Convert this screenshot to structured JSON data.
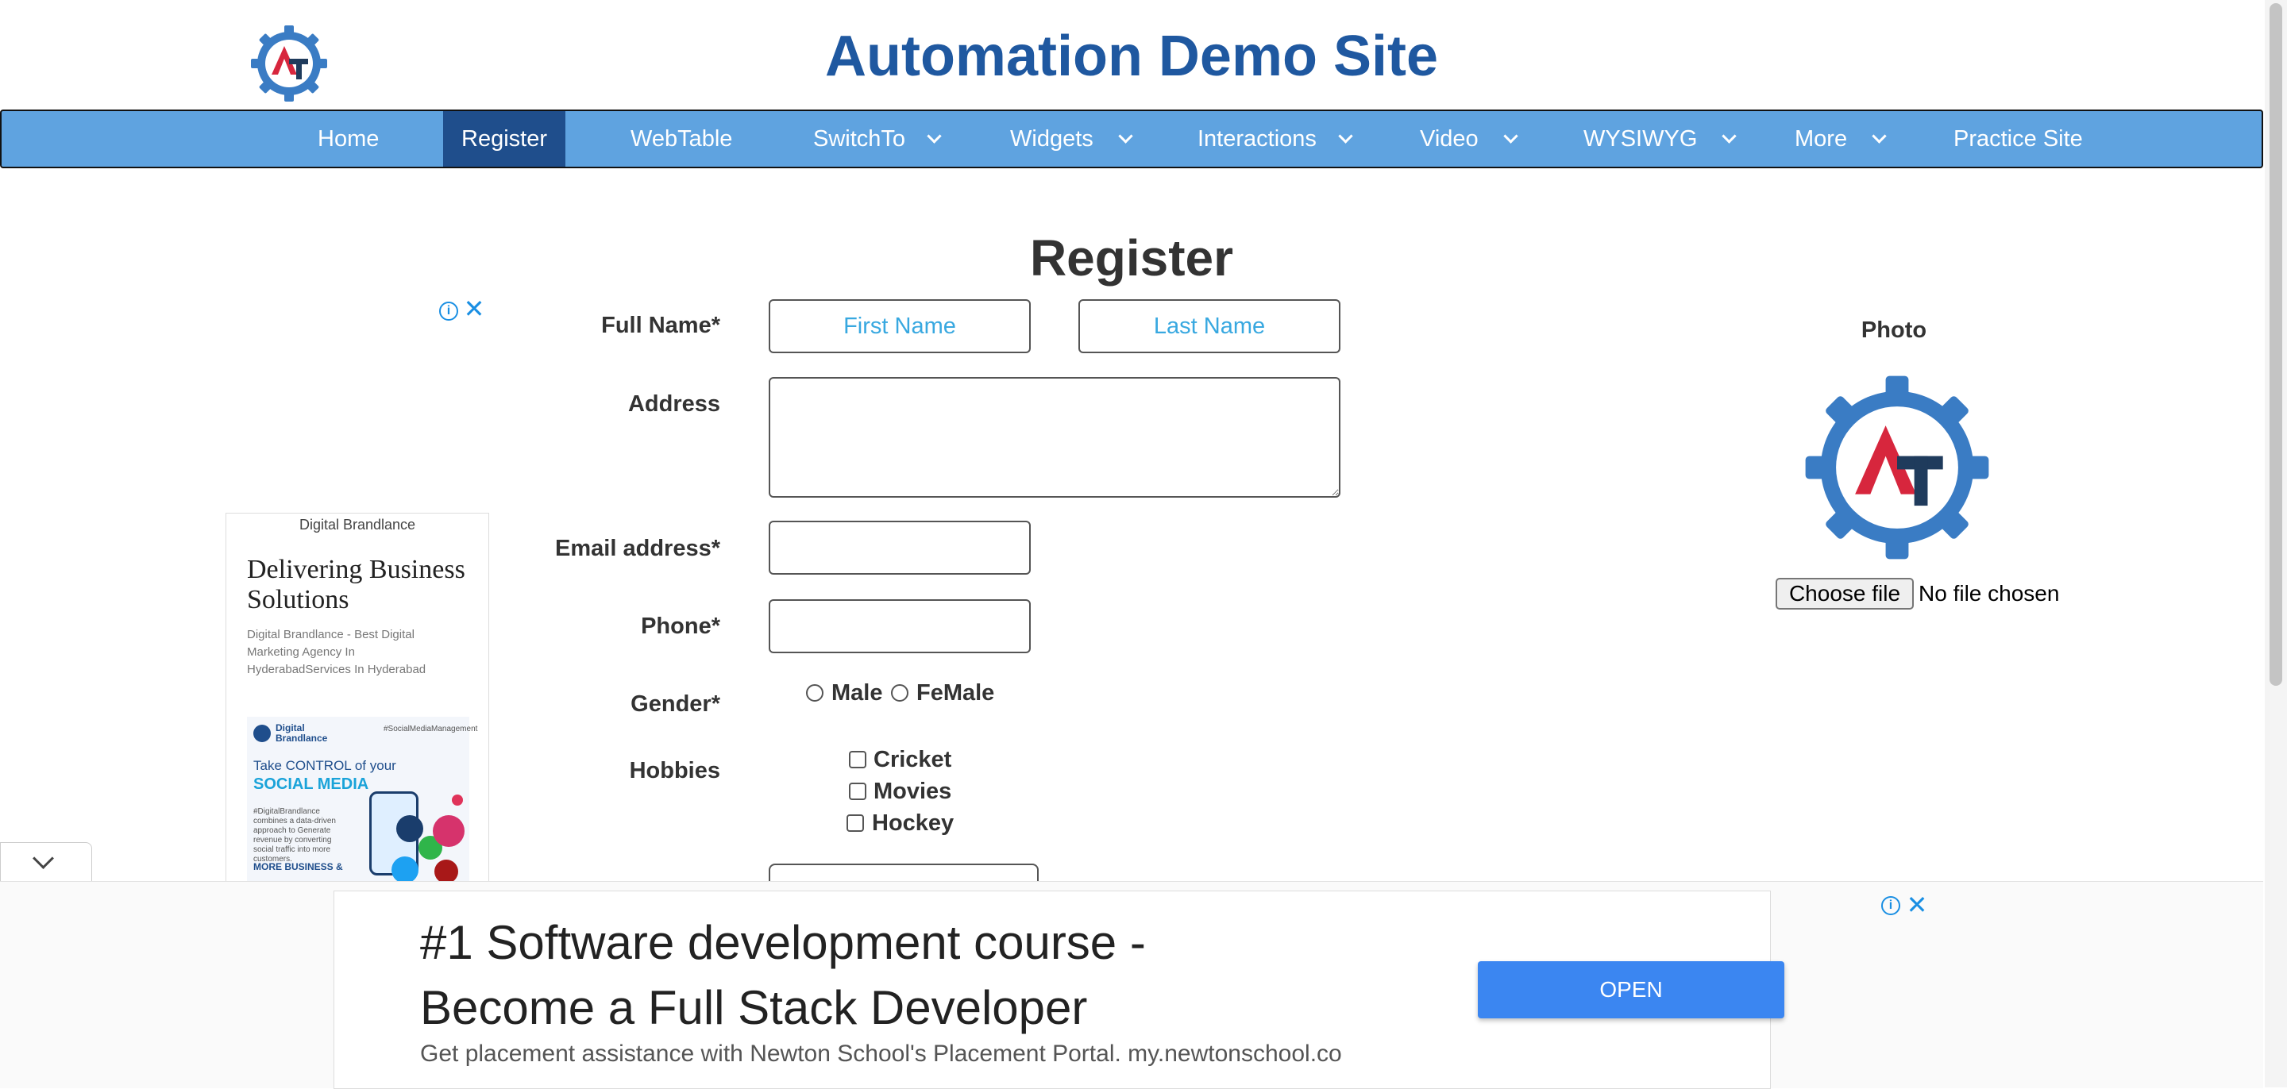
{
  "site": {
    "title": "Automation Demo Site"
  },
  "nav": {
    "items": [
      {
        "label": "Home"
      },
      {
        "label": "Register"
      },
      {
        "label": "WebTable"
      },
      {
        "label": "SwitchTo"
      },
      {
        "label": "Widgets"
      },
      {
        "label": "Interactions"
      },
      {
        "label": "Video"
      },
      {
        "label": "WYSIWYG"
      },
      {
        "label": "More"
      },
      {
        "label": "Practice Site"
      }
    ],
    "active": "Register"
  },
  "form": {
    "heading": "Register",
    "full_name_label": "Full Name*",
    "first_name_placeholder": "First Name",
    "last_name_placeholder": "Last Name",
    "address_label": "Address",
    "email_label": "Email address*",
    "phone_label": "Phone*",
    "gender_label": "Gender*",
    "gender_options": [
      "Male",
      "FeMale"
    ],
    "hobbies_label": "Hobbies",
    "hobbies_options": [
      "Cricket",
      "Movies",
      "Hockey"
    ]
  },
  "photo": {
    "label": "Photo",
    "choose_button": "Choose file",
    "status": "No file chosen"
  },
  "side_ad": {
    "brand": "Digital Brandlance",
    "title": "Delivering Business Solutions",
    "description": "Digital Brandlance - Best Digital Marketing Agency In HyderabadServices In Hyderabad",
    "image_brand": "Digital Brandlance",
    "image_tag": "#SocialMediaManagement",
    "image_take": "Take CONTROL of your",
    "image_social": "SOCIAL MEDIA",
    "image_body": "#DigitalBrandlance combines a data-driven approach to Generate revenue by converting social traffic into more customers.",
    "image_more": "MORE BUSINESS &"
  },
  "bottom_ad": {
    "headline": "#1 Software development course - Become a Full Stack Developer",
    "subtext": "Get placement assistance with Newton School's Placement Portal. my.newtonschool.co",
    "cta": "OPEN"
  },
  "colors": {
    "nav_bg": "#5fa3e0",
    "nav_active": "#1f4e8c",
    "title": "#1f58a0",
    "placeholder": "#38a8e0",
    "ad_button": "#3b86f1",
    "logo_red": "#d7263d",
    "logo_dark": "#1f3b5c",
    "logo_blue": "#3a7cc4"
  },
  "icons": {
    "logo": "automation-testing-gear-logo",
    "ad_info": "info-icon",
    "ad_close": "close-icon",
    "collapse": "chevron-down-icon"
  }
}
